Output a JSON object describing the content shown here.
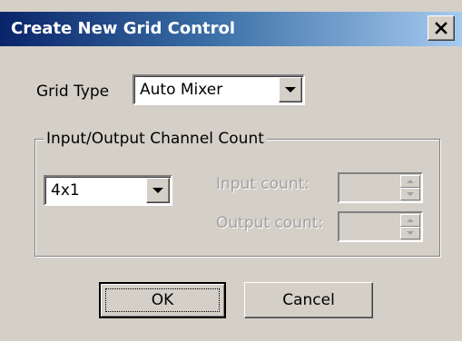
{
  "window": {
    "title": "Create New Grid Control",
    "close_glyph": "✕",
    "close_icon": "close-icon"
  },
  "grid_type": {
    "label": "Grid Type",
    "selected": "Auto Mixer"
  },
  "channel_group": {
    "title": "Input/Output Channel Count",
    "preset_selected": "4x1",
    "input_count_label": "Input count:",
    "input_count_value": "",
    "output_count_label": "Output count:",
    "output_count_value": ""
  },
  "buttons": {
    "ok": "OK",
    "cancel": "Cancel"
  },
  "colors": {
    "title_gradient_start": "#0a246a",
    "title_gradient_end": "#a6caf0",
    "dialog_face": "#d4d0c8",
    "disabled_text": "#a0a0a0"
  }
}
